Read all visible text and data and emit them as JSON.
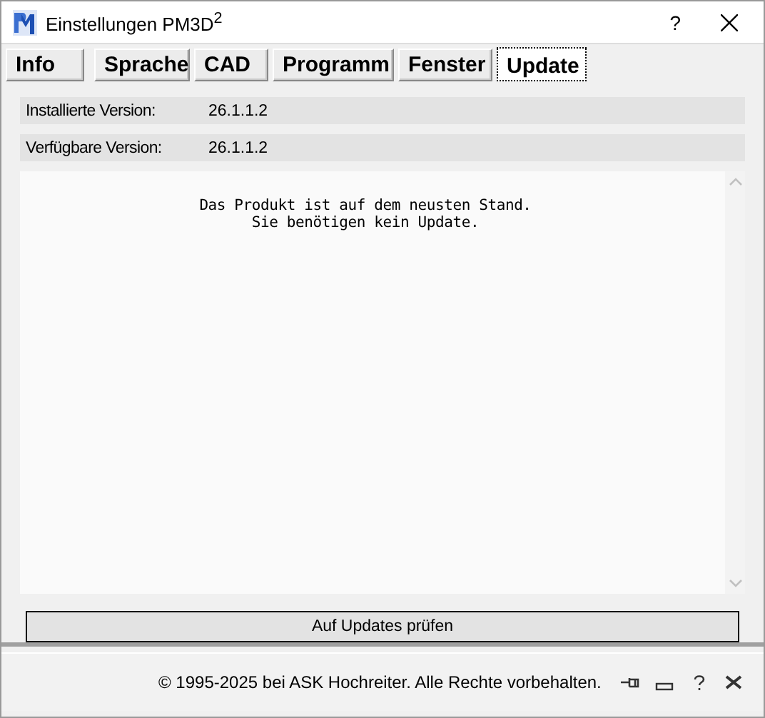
{
  "window": {
    "title": "Einstellungen PM3D$^{2}$",
    "help": "?"
  },
  "tabs": [
    {
      "label": "Info",
      "selected": false
    },
    {
      "label": "Sprache",
      "selected": false
    },
    {
      "label": "CAD",
      "selected": false
    },
    {
      "label": "Programm",
      "selected": false
    },
    {
      "label": "Fenster",
      "selected": false
    },
    {
      "label": "Update",
      "selected": true
    }
  ],
  "versions": [
    {
      "label": "Installierte Version:",
      "value": "26.1.1.2"
    },
    {
      "label": "Verfügbare Version:",
      "value": "26.1.1.2"
    }
  ],
  "message": "Das Produkt ist auf dem neusten Stand.\nSie benötigen kein Update.",
  "check_button": "Auf Updates prüfen",
  "footer": {
    "copyright": "© 1995-2025 bei ASK Hochreiter. Alle Rechte vorbehalten."
  }
}
